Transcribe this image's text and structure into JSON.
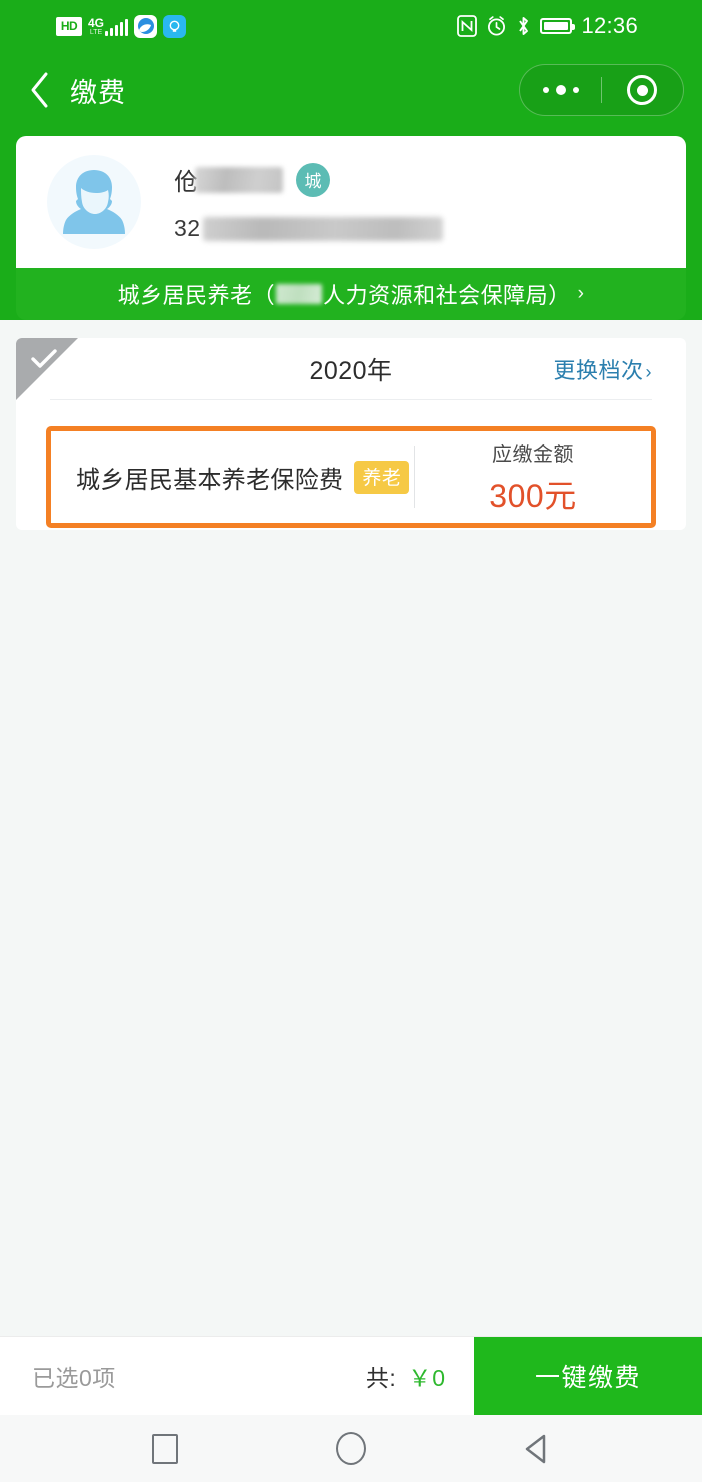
{
  "statusbar": {
    "hd_label": "HD",
    "network_label": "4G",
    "network_sub": "LTE",
    "signal_icon": "signal-bars-icon",
    "app_icon_1": "cloud-app-icon",
    "app_icon_2": "flashlight-app-icon",
    "nfc_icon": "nfc-icon",
    "alarm_icon": "alarm-clock-icon",
    "bluetooth_icon": "bluetooth-icon",
    "battery_icon": "battery-icon",
    "time": "12:36"
  },
  "header": {
    "back_icon": "back-chevron-icon",
    "title": "缴费",
    "menu_icon": "more-options-icon",
    "target_icon": "mini-program-close-icon"
  },
  "user_card": {
    "avatar_icon": "user-avatar-icon",
    "name_visible": "伧",
    "name_redacted": true,
    "type_badge": "城",
    "id_prefix": "32",
    "id_redacted": true
  },
  "org_bar": {
    "prefix": "城乡居民养老（",
    "redacted": true,
    "suffix": "人力资源和社会保障局）",
    "chevron": "›"
  },
  "payment_card": {
    "select_ribbon_icon": "checkmark-ribbon-icon",
    "year": "2020年",
    "change_tier_label": "更换档次",
    "change_tier_chevron": "›",
    "item": {
      "name": "城乡居民基本养老保险费",
      "tag": "养老",
      "amount_label": "应缴金额",
      "amount_value": "300元",
      "selected_border_color": "#f48024"
    }
  },
  "bottom_bar": {
    "selected_text": "已选0项",
    "total_label": "共:",
    "total_amount": "￥0",
    "pay_button_label": "一键缴费"
  },
  "navbar": {
    "recents_icon": "recents-square-icon",
    "home_icon": "home-circle-icon",
    "back_icon": "back-triangle-icon"
  },
  "colors": {
    "brand_green": "#1aad19",
    "accent_orange": "#f48024",
    "amount_red": "#e2512a",
    "link_blue": "#2b7fae",
    "tag_gold": "#f6c945",
    "badge_teal": "#5cbcb4"
  }
}
